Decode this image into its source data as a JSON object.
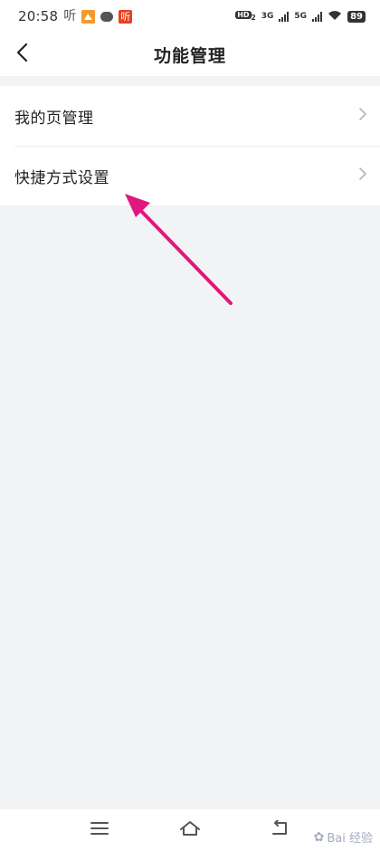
{
  "status_bar": {
    "time": "20:58",
    "app_icon_1": "听",
    "app_icon_3": "听",
    "hd_label": "HD",
    "hd_sub": "2",
    "net1": "3G",
    "net2": "5G",
    "battery": "89"
  },
  "header": {
    "title": "功能管理",
    "back_icon": "chevron-left-icon"
  },
  "list": {
    "items": [
      {
        "label": "我的页管理",
        "icon": "chevron-right-icon"
      },
      {
        "label": "快捷方式设置",
        "icon": "chevron-right-icon"
      }
    ]
  },
  "annotation": {
    "color": "#e0177f"
  },
  "nav_bar": {
    "menu_icon": "menu-icon",
    "home_icon": "home-icon",
    "back_icon": "back-icon"
  },
  "watermark": {
    "text": "Bai 经验"
  },
  "colors": {
    "background": "#f2f3f5",
    "surface": "#ffffff",
    "divider": "#ececec",
    "chevron": "#b5b5b5"
  }
}
